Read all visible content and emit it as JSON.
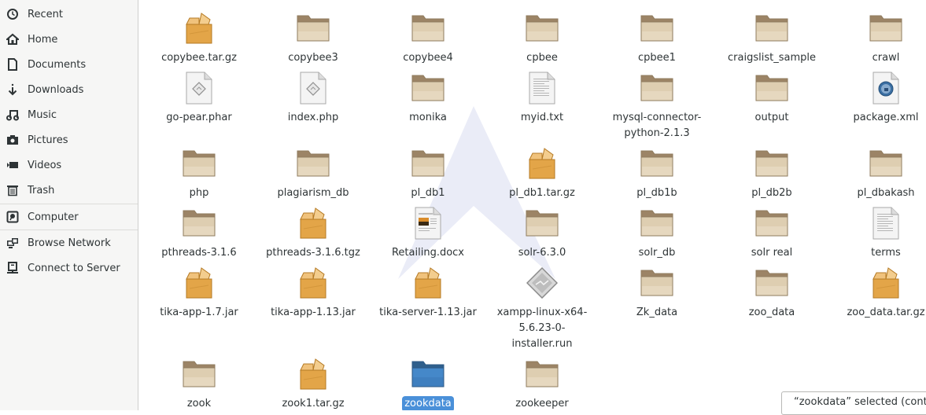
{
  "sidebar": {
    "items": [
      {
        "label": "Recent",
        "icon": "clock-icon"
      },
      {
        "label": "Home",
        "icon": "home-icon"
      },
      {
        "label": "Documents",
        "icon": "document-icon"
      },
      {
        "label": "Downloads",
        "icon": "download-icon"
      },
      {
        "label": "Music",
        "icon": "music-icon"
      },
      {
        "label": "Pictures",
        "icon": "camera-icon"
      },
      {
        "label": "Videos",
        "icon": "video-icon"
      },
      {
        "label": "Trash",
        "icon": "trash-icon"
      },
      {
        "label": "Computer",
        "icon": "computer-icon"
      },
      {
        "label": "Browse Network",
        "icon": "network-icon"
      },
      {
        "label": "Connect to Server",
        "icon": "server-icon"
      }
    ]
  },
  "files": [
    {
      "name": "copybee.tar.gz",
      "type": "archive"
    },
    {
      "name": "copybee3",
      "type": "folder"
    },
    {
      "name": "copybee4",
      "type": "folder"
    },
    {
      "name": "cpbee",
      "type": "folder"
    },
    {
      "name": "cpbee1",
      "type": "folder"
    },
    {
      "name": "craigslist_sample",
      "type": "folder"
    },
    {
      "name": "crawl",
      "type": "folder"
    },
    {
      "name": "go-pear.phar",
      "type": "script"
    },
    {
      "name": "index.php",
      "type": "script"
    },
    {
      "name": "monika",
      "type": "folder"
    },
    {
      "name": "myid.txt",
      "type": "text"
    },
    {
      "name": "mysql-connector-python-2.1.3",
      "type": "folder"
    },
    {
      "name": "output",
      "type": "folder"
    },
    {
      "name": "package.xml",
      "type": "xml"
    },
    {
      "name": "php",
      "type": "folder"
    },
    {
      "name": "plagiarism_db",
      "type": "folder"
    },
    {
      "name": "pl_db1",
      "type": "folder"
    },
    {
      "name": "pl_db1.tar.gz",
      "type": "archive"
    },
    {
      "name": "pl_db1b",
      "type": "folder"
    },
    {
      "name": "pl_db2b",
      "type": "folder"
    },
    {
      "name": "pl_dbakash",
      "type": "folder"
    },
    {
      "name": "pthreads-3.1.6",
      "type": "folder"
    },
    {
      "name": "pthreads-3.1.6.tgz",
      "type": "archive"
    },
    {
      "name": "Retailing.docx",
      "type": "docx"
    },
    {
      "name": "solr-6.3.0",
      "type": "folder"
    },
    {
      "name": "solr_db",
      "type": "folder"
    },
    {
      "name": "solr real",
      "type": "folder"
    },
    {
      "name": "terms",
      "type": "text"
    },
    {
      "name": "tika-app-1.7.jar",
      "type": "archive"
    },
    {
      "name": "tika-app-1.13.jar",
      "type": "archive"
    },
    {
      "name": "tika-server-1.13.jar",
      "type": "archive"
    },
    {
      "name": "xampp-linux-x64-5.6.23-0-installer.run",
      "type": "executable"
    },
    {
      "name": "Zk_data",
      "type": "folder"
    },
    {
      "name": "zoo_data",
      "type": "folder"
    },
    {
      "name": "zoo_data.tar.gz",
      "type": "archive"
    },
    {
      "name": "zook",
      "type": "folder"
    },
    {
      "name": "zook1.tar.gz",
      "type": "archive"
    },
    {
      "name": "zookdata",
      "type": "folder",
      "selected": true
    },
    {
      "name": "zookeeper",
      "type": "folder"
    }
  ],
  "status": {
    "text": "“zookdata” selected  (contair"
  },
  "colors": {
    "selection": "#4a90d9",
    "folder": "#d9c7a8",
    "archive": "#e0a64a"
  }
}
